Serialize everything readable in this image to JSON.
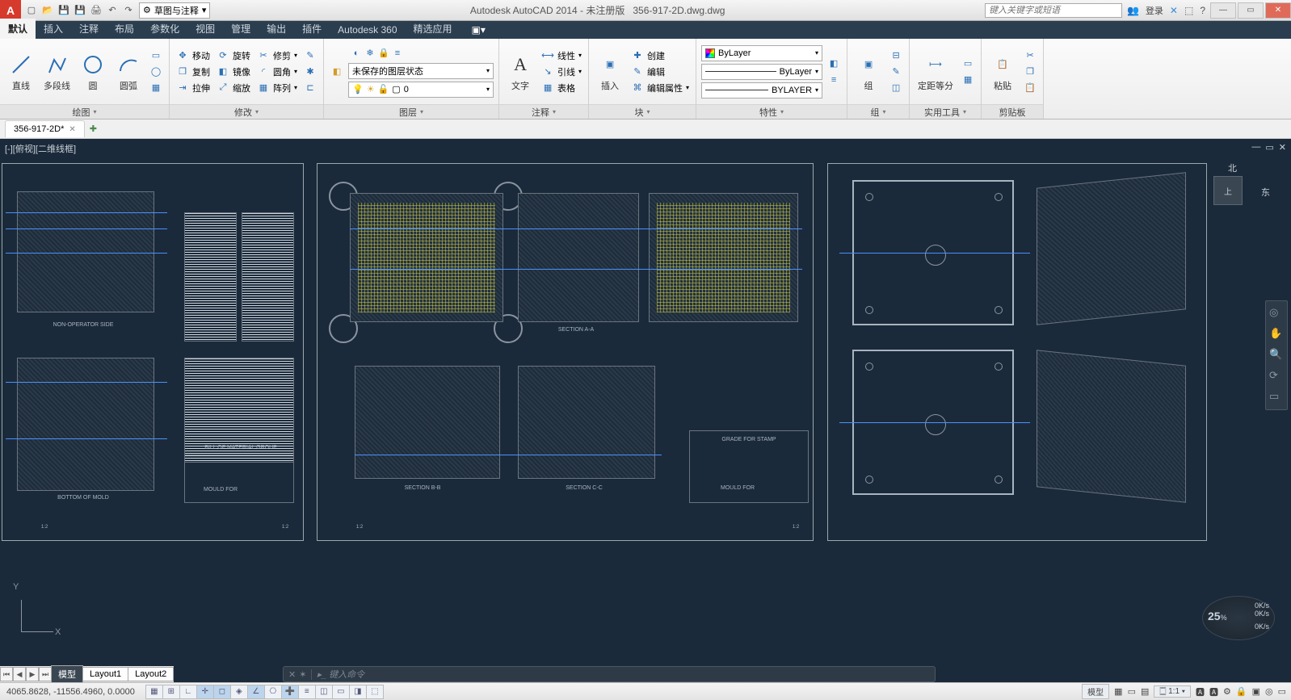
{
  "title": {
    "app": "Autodesk AutoCAD 2014",
    "reg": "未注册版",
    "file": "356-917-2D.dwg.dwg"
  },
  "search_placeholder": "键入关键字或短语",
  "login": "登录",
  "workspace": "草图与注释",
  "ribbon_tabs": [
    "默认",
    "插入",
    "注释",
    "布局",
    "参数化",
    "视图",
    "管理",
    "输出",
    "插件",
    "Autodesk 360",
    "精选应用"
  ],
  "active_ribbon_tab": "默认",
  "panels": {
    "draw": {
      "title": "绘图",
      "big": [
        {
          "n": "line",
          "l": "直线"
        },
        {
          "n": "polyline",
          "l": "多段线"
        },
        {
          "n": "circle",
          "l": "圆"
        },
        {
          "n": "arc",
          "l": "圆弧"
        }
      ]
    },
    "modify": {
      "title": "修改",
      "rows": [
        [
          {
            "l": "移动"
          },
          {
            "l": "旋转"
          },
          {
            "l": "修剪"
          }
        ],
        [
          {
            "l": "复制"
          },
          {
            "l": "镜像"
          },
          {
            "l": "圆角"
          }
        ],
        [
          {
            "l": "拉伸"
          },
          {
            "l": "缩放"
          },
          {
            "l": "阵列"
          }
        ]
      ]
    },
    "layers": {
      "title": "图层",
      "state": "未保存的图层状态",
      "current": "0"
    },
    "annotate": {
      "title": "注释",
      "text": "文字",
      "rows": [
        "线性",
        "引线",
        "表格"
      ]
    },
    "block": {
      "title": "块",
      "insert": "插入",
      "rows": [
        "创建",
        "编辑",
        "编辑属性"
      ]
    },
    "props": {
      "title": "特性",
      "color": "ByLayer",
      "ltype": "ByLayer",
      "lweight": "BYLAYER"
    },
    "group": {
      "title": "组",
      "btn": "组"
    },
    "util": {
      "title": "实用工具",
      "btn": "定距等分"
    },
    "clip": {
      "title": "剪贴板",
      "btn": "粘贴"
    }
  },
  "file_tab": "356-917-2D*",
  "view_caption": "[-][俯视][二维线框]",
  "drawing_labels": {
    "nonop": "NON-OPERATOR SIDE",
    "bottom": "BOTTOM OF MOLD",
    "secBB": "SECTION B-B",
    "secAA": "SECTION A-A",
    "secCC": "SECTION C-C",
    "mould": "MOULD FOR",
    "grade": "GRADE FOR STAMP",
    "bom": "BILL OF MATERIAL GROUP"
  },
  "navcube": {
    "face": "上",
    "n": "北",
    "e": "东"
  },
  "cmd_placeholder": "键入命令",
  "layout_tabs": [
    "模型",
    "Layout1",
    "Layout2"
  ],
  "status": {
    "coords": "4065.8628, -11556.4960, 0.0000",
    "model": "模型",
    "scale": "1:1",
    "perf": {
      "pct": "25",
      "unit": "%",
      "k1": "0K/s",
      "k2": "0K/s",
      "k3": "0K/s"
    }
  },
  "ucs": {
    "x": "X",
    "y": "Y"
  }
}
